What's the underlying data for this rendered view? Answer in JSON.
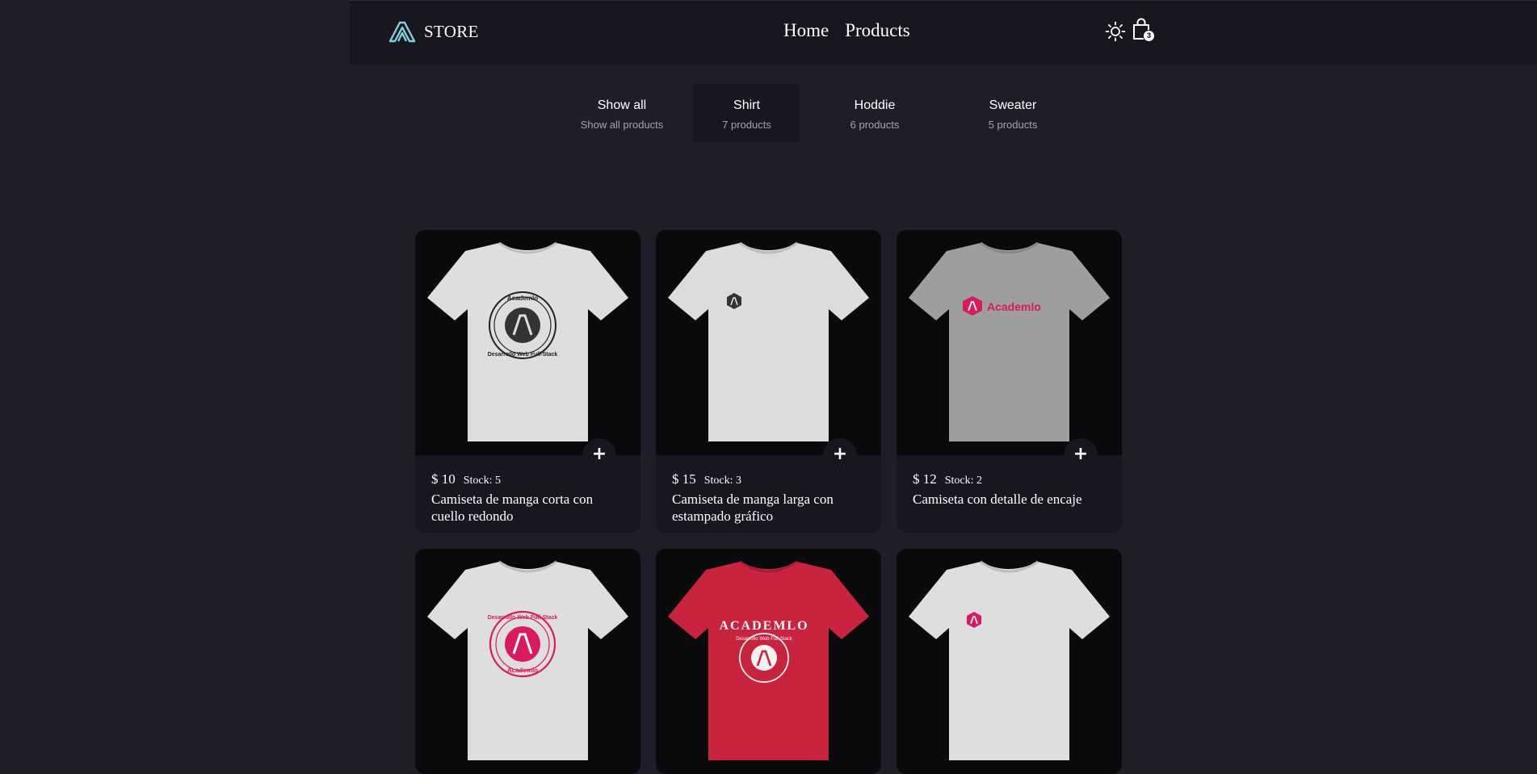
{
  "header": {
    "logo_text": "STORE",
    "nav": [
      {
        "label": "Home"
      },
      {
        "label": "Products"
      }
    ],
    "cart_count": "3"
  },
  "filters": [
    {
      "name": "Show all",
      "count": "Show all products",
      "active": false
    },
    {
      "name": "Shirt",
      "count": "7 products",
      "active": true
    },
    {
      "name": "Hoddie",
      "count": "6 products",
      "active": false
    },
    {
      "name": "Sweater",
      "count": "5 products",
      "active": false
    }
  ],
  "products": [
    {
      "price": "$ 10",
      "stock": "Stock: 5",
      "title": "Camiseta de manga corta con cuello redondo",
      "shirt_color": "#dedede",
      "print": "round-seal-dark",
      "print_text": [
        "Academlo",
        "Desarrollo Web Full-Stack"
      ]
    },
    {
      "price": "$ 15",
      "stock": "Stock: 3",
      "title": "Camiseta de manga larga con estampado gráfico",
      "shirt_color": "#dcdcdc",
      "print": "small-chest-dark"
    },
    {
      "price": "$ 12",
      "stock": "Stock: 2",
      "title": "Camiseta con detalle de encaje",
      "shirt_color": "#9e9e9e",
      "print": "wordmark-pink",
      "print_text": [
        "Academlo"
      ]
    },
    {
      "price": "",
      "stock": "",
      "title": "",
      "shirt_color": "#dedede",
      "print": "round-seal-pink",
      "print_text": [
        "Desarrollo Web Full-Stack",
        "Academlo"
      ]
    },
    {
      "price": "",
      "stock": "",
      "title": "",
      "shirt_color": "#c8243f",
      "print": "college-white",
      "print_text": [
        "ACADEMLO",
        "Desarrollo Web Full-Stack"
      ]
    },
    {
      "price": "",
      "stock": "",
      "title": "",
      "shirt_color": "#dedede",
      "print": "small-chest-pink"
    }
  ],
  "colors": {
    "background": "#1e1e29",
    "surface": "#17171f",
    "image_bg": "#0a0a0d",
    "accent_pink": "#d81b60",
    "muted_text": "#a4a4ae"
  }
}
